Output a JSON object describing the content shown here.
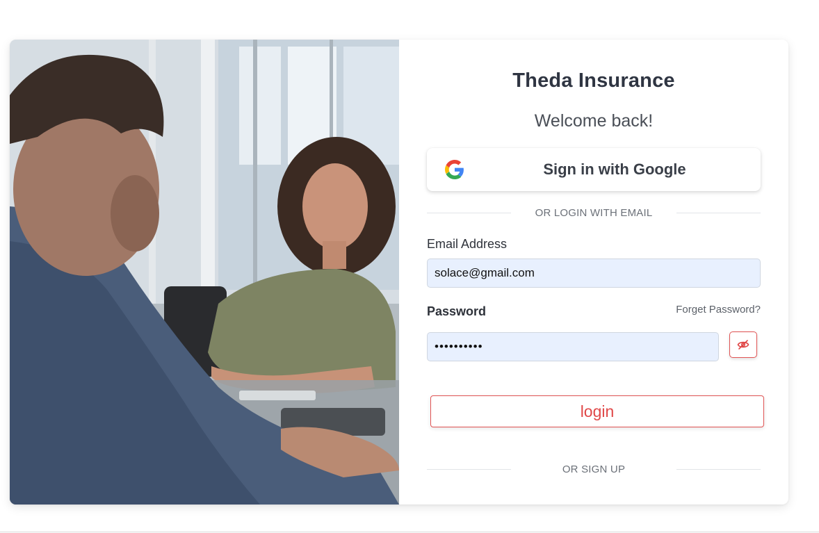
{
  "brand": "Theda Insurance",
  "welcome": "Welcome back!",
  "google_button": {
    "label": "Sign in with Google",
    "icon": "google-icon"
  },
  "divider_email": "OR LOGIN WITH EMAIL",
  "email": {
    "label": "Email Address",
    "value": "solace@gmail.com",
    "placeholder": ""
  },
  "password": {
    "label": "Password",
    "value": "••••••••••",
    "forgot_link": "Forget Password?",
    "toggle_icon": "eye-slash-icon"
  },
  "login_button": "login",
  "divider_signup": "OR SIGN UP",
  "colors": {
    "accent": "#e05252",
    "input_bg": "#e8f0fe",
    "text_dark": "#2f3542"
  }
}
